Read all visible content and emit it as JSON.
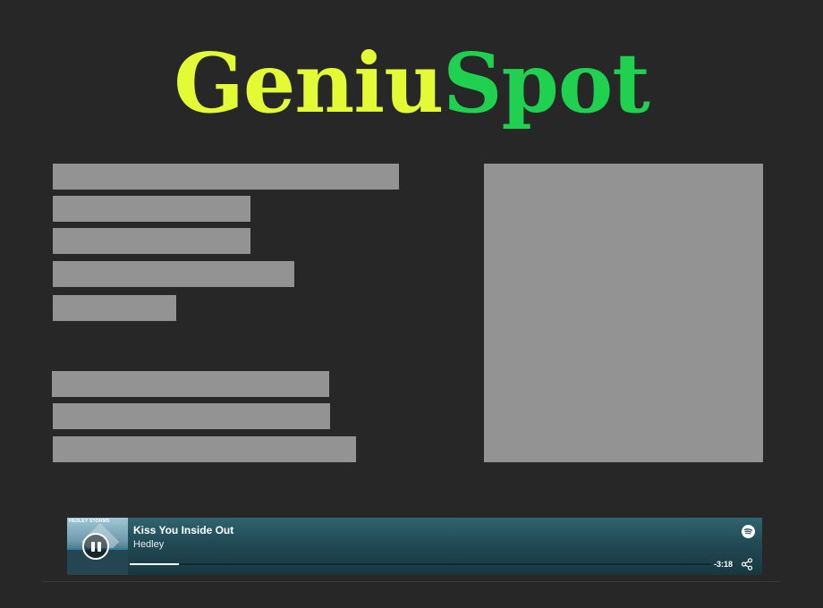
{
  "logo": {
    "part1": "Geniu",
    "part2": "Spot",
    "part1_color": "#e2fb35",
    "part2_color": "#1fd14f"
  },
  "placeholder_color": "#939393",
  "player": {
    "album_art_label": "HEDLEY STORMS",
    "track_title": "Kiss You Inside Out",
    "artist": "Hedley",
    "time_remaining": "-3:18",
    "progress_fraction": 0.085,
    "state": "playing",
    "icons": {
      "play_pause": "pause-icon",
      "brand": "spotify-icon",
      "share": "share-icon"
    }
  }
}
